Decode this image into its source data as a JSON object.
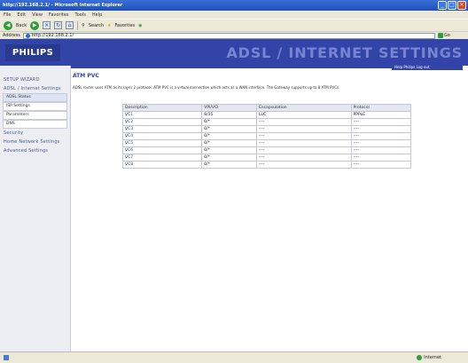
{
  "browser": {
    "title": "http://192.168.2.1/ - Microsoft Internet Explorer",
    "menu": [
      "File",
      "Edit",
      "View",
      "Favorites",
      "Tools",
      "Help"
    ],
    "toolbar": {
      "back": "Back",
      "search": "Search",
      "favorites": "Favorites"
    },
    "address_label": "Address",
    "address_value": "http://192.168.2.1/",
    "go_label": "Go",
    "status_zone": "Internet"
  },
  "header": {
    "logo": "PHILIPS",
    "title": "ADSL / INTERNET SETTINGS",
    "help": "Help  Philips Log out"
  },
  "sidebar": {
    "setup_wizard": "SETUP WIZARD",
    "adsl_settings": "ADSL / Internet Settings",
    "sub": [
      "ADSL Status",
      "ISP Settings",
      "Parameters",
      "DNS"
    ],
    "security": "Security",
    "home_network": "Home Network Settings",
    "advanced": "Advanced Settings"
  },
  "main": {
    "title": "ATM PVC",
    "description": "ADSL router uses ATM as its layer 2 protocol. ATM PVC is a virtual connection which acts as a WAN interface. The Gateway supports up to 8 ATM PVCs.",
    "columns": [
      "Description",
      "VPI/VCI",
      "Encapsulation",
      "Protocol"
    ],
    "rows": [
      [
        "VC1",
        "8/35",
        "LLC",
        "PPPoE"
      ],
      [
        "VC2",
        "0/*",
        "----",
        "----"
      ],
      [
        "VC3",
        "0/*",
        "----",
        "----"
      ],
      [
        "VC4",
        "0/*",
        "----",
        "----"
      ],
      [
        "VC5",
        "0/*",
        "----",
        "----"
      ],
      [
        "VC6",
        "0/*",
        "----",
        "----"
      ],
      [
        "VC7",
        "0/*",
        "----",
        "----"
      ],
      [
        "VC8",
        "0/*",
        "----",
        "----"
      ]
    ]
  }
}
